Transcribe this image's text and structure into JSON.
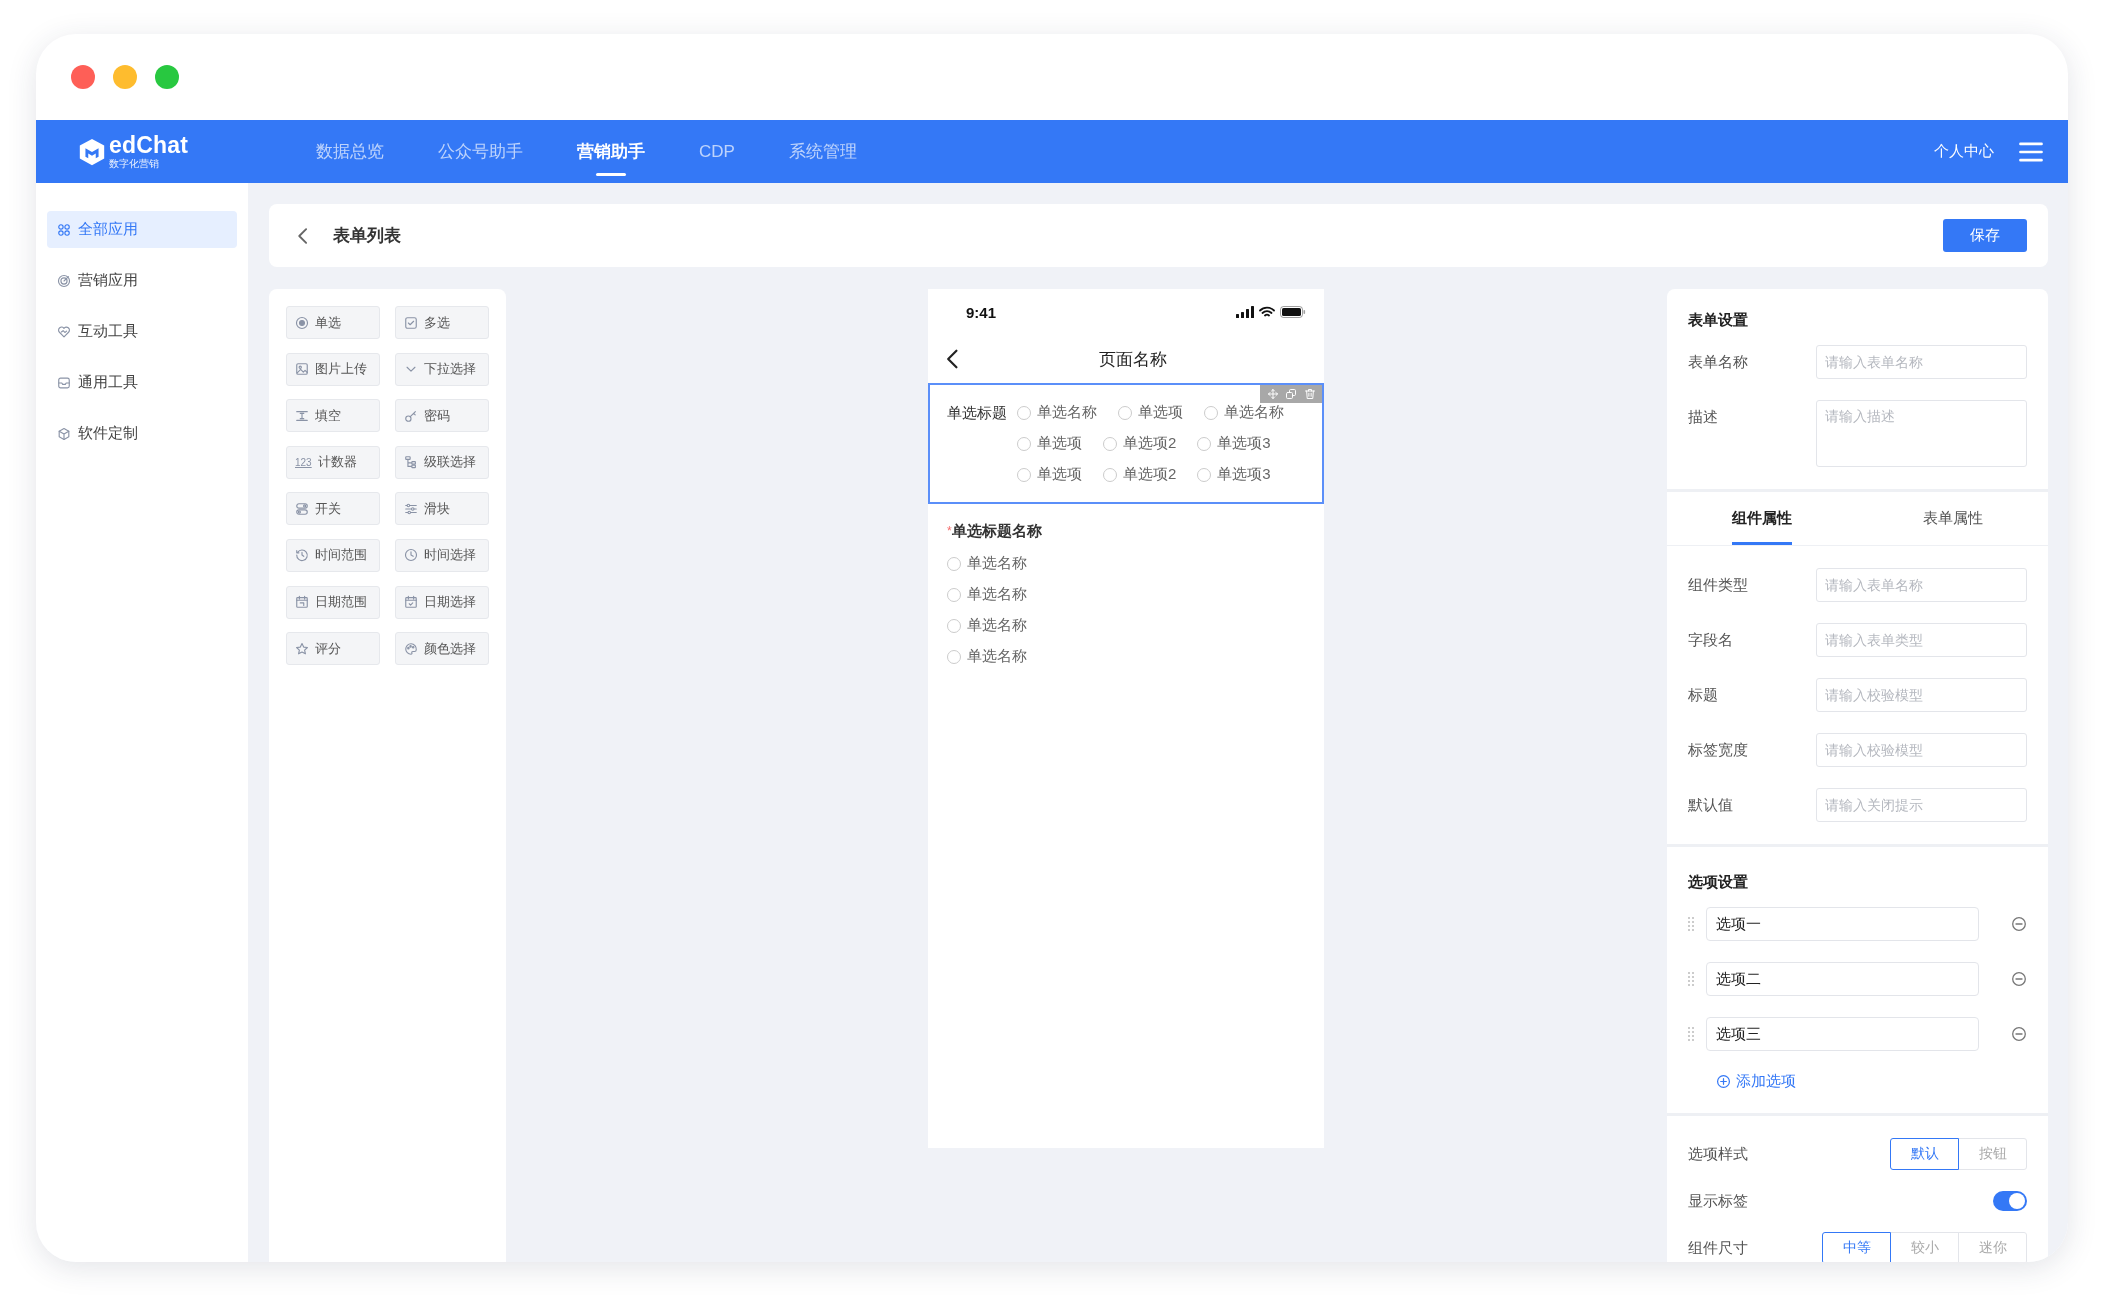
{
  "window": {
    "controls": [
      {
        "color": "#fe5f57"
      },
      {
        "color": "#febc2e"
      },
      {
        "color": "#28c840"
      }
    ]
  },
  "navbar": {
    "logo": {
      "text": "edChat",
      "subtitle": "数字化营销"
    },
    "tabs": [
      {
        "label": "数据总览",
        "selected": false
      },
      {
        "label": "公众号助手",
        "selected": false
      },
      {
        "label": "营销助手",
        "selected": true
      },
      {
        "label": "CDP",
        "selected": false
      },
      {
        "label": "系统管理",
        "selected": false
      }
    ],
    "user": "个人中心"
  },
  "sidebar": {
    "items": [
      {
        "label": "全部应用",
        "selected": true
      },
      {
        "label": "营销应用",
        "selected": false
      },
      {
        "label": "互动工具",
        "selected": false
      },
      {
        "label": "通用工具",
        "selected": false
      },
      {
        "label": "软件定制",
        "selected": false
      }
    ]
  },
  "page_header": {
    "title": "表单列表",
    "save": "保存"
  },
  "palette": {
    "items": [
      {
        "label": "单选"
      },
      {
        "label": "多选"
      },
      {
        "label": "图片上传"
      },
      {
        "label": "下拉选择"
      },
      {
        "label": "填空"
      },
      {
        "label": "密码"
      },
      {
        "label": "计数器",
        "icon_text": "123"
      },
      {
        "label": "级联选择"
      },
      {
        "label": "开关"
      },
      {
        "label": "滑块"
      },
      {
        "label": "时间范围"
      },
      {
        "label": "时间选择"
      },
      {
        "label": "日期范围"
      },
      {
        "label": "日期选择"
      },
      {
        "label": "评分"
      },
      {
        "label": "颜色选择"
      }
    ]
  },
  "phone": {
    "time": "9:41",
    "title": "页面名称",
    "fields": [
      {
        "kind": "inline",
        "label": "单选标题",
        "selected": true,
        "rows": [
          [
            {
              "label": "单选名称",
              "selected": false
            },
            {
              "label": "单选项",
              "selected": false
            },
            {
              "label": "单选名称",
              "selected": false
            }
          ],
          [
            {
              "label": "单选项",
              "selected": false
            },
            {
              "label": "单选项2",
              "selected": false
            },
            {
              "label": "单选项3",
              "selected": false
            }
          ],
          [
            {
              "label": "单选项",
              "selected": false
            },
            {
              "label": "单选项2",
              "selected": false
            },
            {
              "label": "单选项3",
              "selected": false
            }
          ]
        ]
      },
      {
        "kind": "stacked",
        "label": "单选标题名称",
        "required_mark": "*",
        "selected": false,
        "options": [
          {
            "label": "单选名称",
            "selected": false
          },
          {
            "label": "单选名称",
            "selected": false
          },
          {
            "label": "单选名称",
            "selected": false
          },
          {
            "label": "单选名称",
            "selected": false
          }
        ]
      }
    ]
  },
  "form_settings": {
    "title": "表单设置",
    "fields": [
      {
        "kind": "input",
        "label": "表单名称",
        "placeholder": "请输入表单名称"
      },
      {
        "kind": "textarea",
        "label": "描述",
        "placeholder": "请输入描述"
      }
    ]
  },
  "property_tabs": [
    {
      "label": "组件属性",
      "selected": true
    },
    {
      "label": "表单属性",
      "selected": false
    }
  ],
  "properties": [
    {
      "label": "组件类型",
      "placeholder": "请输入表单名称"
    },
    {
      "label": "字段名",
      "placeholder": "请输入表单类型"
    },
    {
      "label": "标题",
      "placeholder": "请输入校验模型"
    },
    {
      "label": "标签宽度",
      "placeholder": "请输入校验模型"
    },
    {
      "label": "默认值",
      "placeholder": "请输入关闭提示"
    }
  ],
  "option_settings": {
    "title": "选项设置",
    "options": [
      {
        "value": "选项一"
      },
      {
        "value": "选项二"
      },
      {
        "value": "选项三"
      }
    ],
    "add": "添加选项"
  },
  "display_settings": [
    {
      "kind": "segmented",
      "label": "选项样式",
      "segments": [
        {
          "label": "默认",
          "selected": true
        },
        {
          "label": "按钮",
          "selected": false
        }
      ]
    },
    {
      "kind": "toggle",
      "label": "显示标签",
      "on": true
    },
    {
      "kind": "segmented",
      "label": "组件尺寸",
      "segments": [
        {
          "label": "中等",
          "selected": true
        },
        {
          "label": "较小",
          "selected": false
        },
        {
          "label": "迷你",
          "selected": false
        }
      ]
    }
  ]
}
